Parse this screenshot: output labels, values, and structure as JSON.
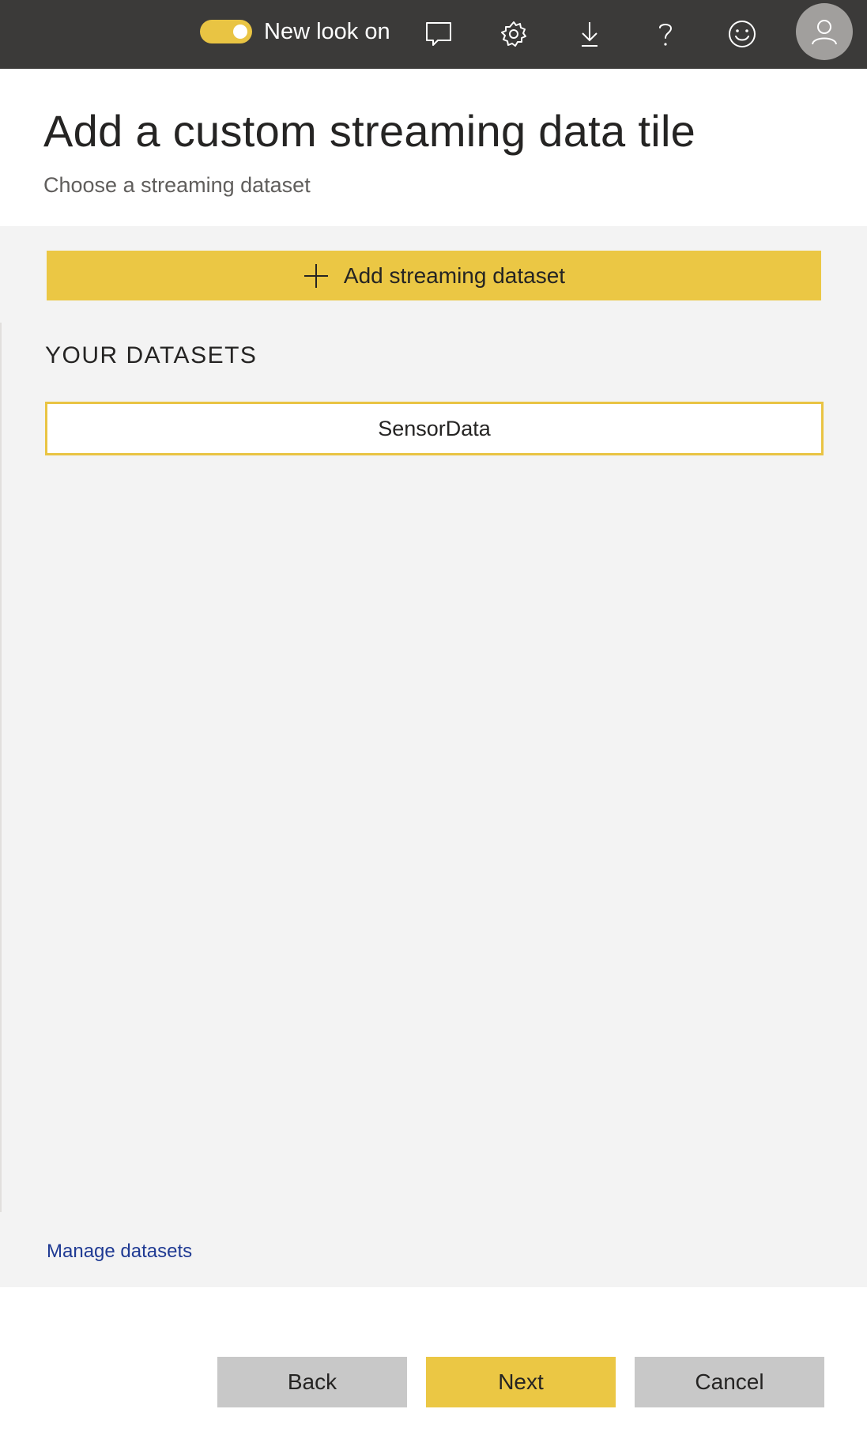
{
  "topbar": {
    "toggle_label": "New look on",
    "toggle_on": true,
    "icons": [
      "comment-icon",
      "gear-icon",
      "download-icon",
      "help-icon",
      "smiley-icon",
      "user-avatar-icon"
    ]
  },
  "header": {
    "title": "Add a custom streaming data tile",
    "subtitle": "Choose a streaming dataset"
  },
  "panel": {
    "add_button_label": "Add streaming dataset",
    "section_heading": "YOUR DATASETS",
    "datasets": [
      "SensorData"
    ],
    "manage_link": "Manage datasets"
  },
  "footer": {
    "back_label": "Back",
    "next_label": "Next",
    "cancel_label": "Cancel"
  },
  "colors": {
    "topbar_bg": "#3b3a39",
    "accent_yellow": "#ebc744",
    "panel_bg": "#f3f3f3",
    "link_blue": "#1f3a93",
    "secondary_button": "#c8c8c8"
  }
}
